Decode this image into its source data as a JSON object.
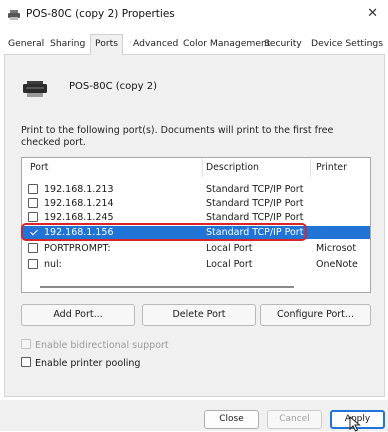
{
  "window": {
    "title": "POS-80C (copy 2) Properties",
    "close_glyph": "✕"
  },
  "tabs": [
    {
      "label": "General"
    },
    {
      "label": "Sharing"
    },
    {
      "label": "Ports"
    },
    {
      "label": "Advanced"
    },
    {
      "label": "Color Management"
    },
    {
      "label": "Security"
    },
    {
      "label": "Device Settings"
    }
  ],
  "active_tab": "Ports",
  "printer": {
    "name": "POS-80C (copy 2)",
    "icon": "printer-icon"
  },
  "instructions": "Print to the following port(s). Documents will print to the first free checked port.",
  "ports_table": {
    "columns": [
      "Port",
      "Description",
      "Printer"
    ],
    "rows": [
      {
        "port": "192.168.1.213",
        "description": "Standard TCP/IP Port",
        "printer": "",
        "checked": false,
        "selected": false
      },
      {
        "port": "192.168.1.214",
        "description": "Standard TCP/IP Port",
        "printer": "",
        "checked": false,
        "selected": false
      },
      {
        "port": "192.168.1.245",
        "description": "Standard TCP/IP Port",
        "printer": "",
        "checked": false,
        "selected": false
      },
      {
        "port": "192.168.1.156",
        "description": "Standard TCP/IP Port",
        "printer": "",
        "checked": true,
        "selected": true
      },
      {
        "port": "PORTPROMPT:",
        "description": "Local Port",
        "printer": "Microsot",
        "checked": false,
        "selected": false
      },
      {
        "port": "nul:",
        "description": "Local Port",
        "printer": "OneNote",
        "checked": false,
        "selected": false
      }
    ]
  },
  "port_buttons": {
    "add": "Add Port...",
    "delete": "Delete Port",
    "configure": "Configure Port..."
  },
  "options": {
    "bidirectional": {
      "label": "Enable bidirectional support",
      "checked": false,
      "enabled": false
    },
    "pooling": {
      "label": "Enable printer pooling",
      "checked": false,
      "enabled": true
    }
  },
  "footer": {
    "close": "Close",
    "cancel": "Cancel",
    "apply": "Apply"
  },
  "colors": {
    "selection": "#1f74d6",
    "highlight_outline": "#d7252a"
  }
}
